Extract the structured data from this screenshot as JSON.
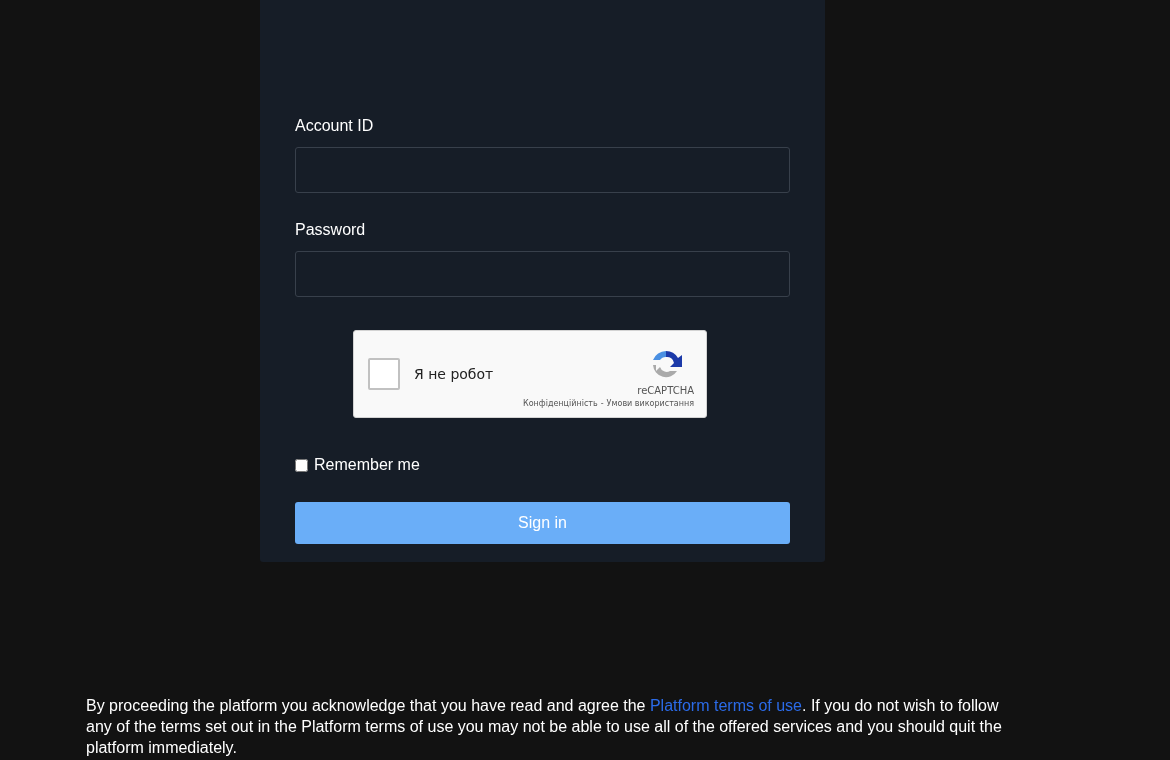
{
  "form": {
    "fields": [
      {
        "label": "Account ID"
      },
      {
        "label": "Password"
      }
    ],
    "captcha": {
      "checked": false,
      "label": "Я не робот",
      "brand": "reCAPTCHA",
      "privacy": "Конфіденційність",
      "separator": "-",
      "terms": "Умови використання"
    },
    "remember": {
      "checked": false,
      "label": "Remember me"
    },
    "submit": "Sign in"
  },
  "notice": {
    "before": "By proceeding the platform you acknowledge that you have read and agree the ",
    "link": "Platform terms of use",
    "after": ". If you do not wish to follow any of the terms set out in the Platform terms of use you may not be able to use all of the offered services and you should quit the platform immediately."
  }
}
